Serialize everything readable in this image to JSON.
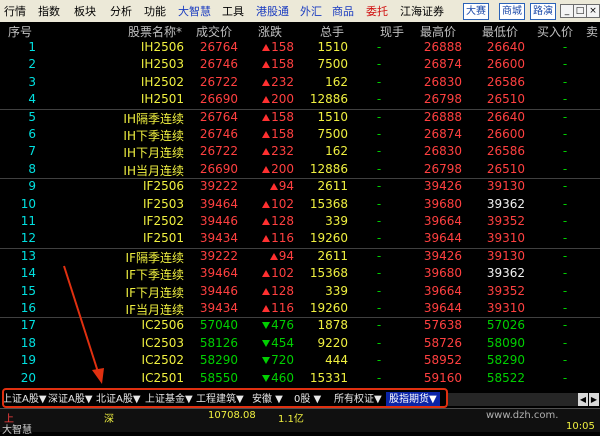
{
  "menu": {
    "items": [
      "行情",
      "指数",
      "板块",
      "分析",
      "功能",
      "大智慧",
      "工具",
      "港股通",
      "外汇",
      "商品",
      "委托",
      "江海证券"
    ],
    "brand_buttons": [
      "大赛",
      "商城",
      "路演"
    ],
    "window_controls": [
      "_",
      "□",
      "×"
    ]
  },
  "header": {
    "columns": [
      "序号",
      "股票名称*",
      "成交价",
      "涨跌",
      "总手",
      "现手",
      "最高价",
      "最低价",
      "买入价",
      "卖"
    ]
  },
  "rows": [
    {
      "idx": "1",
      "name": "IH2506",
      "price": "26764",
      "chg": "158",
      "dir": "up",
      "vol": "1510",
      "cur": "-",
      "high": "26888",
      "low": "26640",
      "bid": "-"
    },
    {
      "idx": "2",
      "name": "IH2503",
      "price": "26746",
      "chg": "158",
      "dir": "up",
      "vol": "7500",
      "cur": "-",
      "high": "26874",
      "low": "26600",
      "bid": "-"
    },
    {
      "idx": "3",
      "name": "IH2502",
      "price": "26722",
      "chg": "232",
      "dir": "up",
      "vol": "162",
      "cur": "-",
      "high": "26830",
      "low": "26586",
      "bid": "-"
    },
    {
      "idx": "4",
      "name": "IH2501",
      "price": "26690",
      "chg": "200",
      "dir": "up",
      "vol": "12886",
      "cur": "-",
      "high": "26798",
      "low": "26510",
      "bid": "-"
    },
    {
      "idx": "5",
      "name": "IH隔季连续",
      "price": "26764",
      "chg": "158",
      "dir": "up",
      "vol": "1510",
      "cur": "-",
      "high": "26888",
      "low": "26640",
      "bid": "-"
    },
    {
      "idx": "6",
      "name": "IH下季连续",
      "price": "26746",
      "chg": "158",
      "dir": "up",
      "vol": "7500",
      "cur": "-",
      "high": "26874",
      "low": "26600",
      "bid": "-"
    },
    {
      "idx": "7",
      "name": "IH下月连续",
      "price": "26722",
      "chg": "232",
      "dir": "up",
      "vol": "162",
      "cur": "-",
      "high": "26830",
      "low": "26586",
      "bid": "-"
    },
    {
      "idx": "8",
      "name": "IH当月连续",
      "price": "26690",
      "chg": "200",
      "dir": "up",
      "vol": "12886",
      "cur": "-",
      "high": "26798",
      "low": "26510",
      "bid": "-"
    },
    {
      "idx": "9",
      "name": "IF2506",
      "price": "39222",
      "chg": "94",
      "dir": "up",
      "vol": "2611",
      "cur": "-",
      "high": "39426",
      "low": "39130",
      "bid": "-"
    },
    {
      "idx": "10",
      "name": "IF2503",
      "price": "39464",
      "chg": "102",
      "dir": "up",
      "vol": "15368",
      "cur": "-",
      "high": "39680",
      "low": "39362",
      "bid": "-"
    },
    {
      "idx": "11",
      "name": "IF2502",
      "price": "39446",
      "chg": "128",
      "dir": "up",
      "vol": "339",
      "cur": "-",
      "high": "39664",
      "low": "39352",
      "bid": "-"
    },
    {
      "idx": "12",
      "name": "IF2501",
      "price": "39434",
      "chg": "116",
      "dir": "up",
      "vol": "19260",
      "cur": "-",
      "high": "39644",
      "low": "39310",
      "bid": "-"
    },
    {
      "idx": "13",
      "name": "IF隔季连续",
      "price": "39222",
      "chg": "94",
      "dir": "up",
      "vol": "2611",
      "cur": "-",
      "high": "39426",
      "low": "39130",
      "bid": "-"
    },
    {
      "idx": "14",
      "name": "IF下季连续",
      "price": "39464",
      "chg": "102",
      "dir": "up",
      "vol": "15368",
      "cur": "-",
      "high": "39680",
      "low": "39362",
      "bid": "-"
    },
    {
      "idx": "15",
      "name": "IF下月连续",
      "price": "39446",
      "chg": "128",
      "dir": "up",
      "vol": "339",
      "cur": "-",
      "high": "39664",
      "low": "39352",
      "bid": "-"
    },
    {
      "idx": "16",
      "name": "IF当月连续",
      "price": "39434",
      "chg": "116",
      "dir": "up",
      "vol": "19260",
      "cur": "-",
      "high": "39644",
      "low": "39310",
      "bid": "-"
    },
    {
      "idx": "17",
      "name": "IC2506",
      "price": "57040",
      "chg": "476",
      "dir": "down",
      "vol": "1878",
      "cur": "-",
      "high": "57638",
      "low": "57026",
      "bid": "-"
    },
    {
      "idx": "18",
      "name": "IC2503",
      "price": "58126",
      "chg": "454",
      "dir": "down",
      "vol": "9220",
      "cur": "-",
      "high": "58726",
      "low": "58090",
      "bid": "-"
    },
    {
      "idx": "19",
      "name": "IC2502",
      "price": "58290",
      "chg": "720",
      "dir": "down",
      "vol": "444",
      "cur": "-",
      "high": "58952",
      "low": "58290",
      "bid": "-"
    },
    {
      "idx": "20",
      "name": "IC2501",
      "price": "58550",
      "chg": "460",
      "dir": "down",
      "vol": "15331",
      "cur": "-",
      "high": "59160",
      "low": "58522",
      "bid": "-"
    }
  ],
  "tabs": [
    "上证A股▼",
    "深证A股▼",
    "北证A股▼",
    "上证基金▼",
    "工程建筑▼",
    "安徽 ▼",
    "0股 ▼",
    "所有权证▼",
    "股指期货▼"
  ],
  "status": {
    "site": "www.dzh.com.",
    "app_name": "大智慧",
    "ticker_left": "上",
    "ticker_mid": "深",
    "ticker_value": "10708.08",
    "ticker_amount": "1.1亿",
    "time": "10:05"
  },
  "colors": {
    "rise": "#ff4040",
    "fall": "#00d000",
    "highlight_border": "#e03010"
  }
}
